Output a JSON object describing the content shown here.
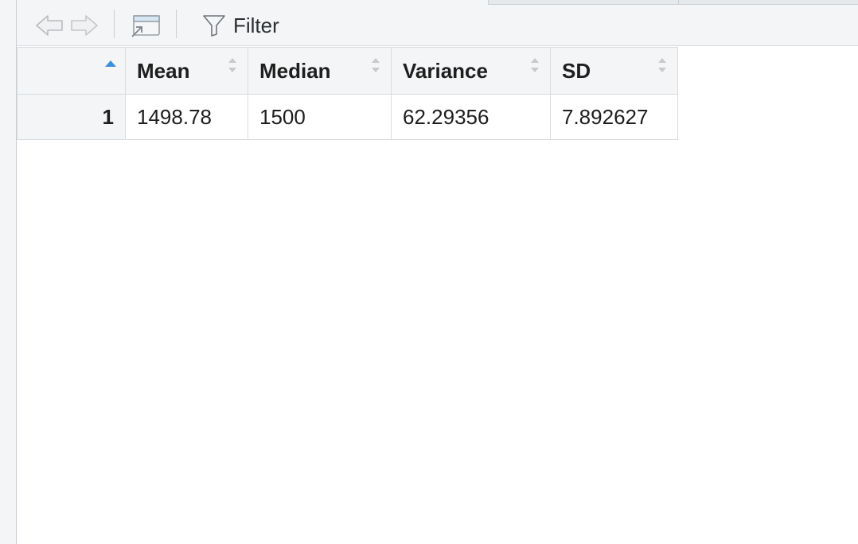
{
  "toolbar": {
    "back_icon": "arrow-left-icon",
    "forward_icon": "arrow-right-icon",
    "popout_icon": "popout-window-icon",
    "filter_icon": "funnel-icon",
    "filter_label": "Filter"
  },
  "table": {
    "sorted_column": "row-index",
    "sort_direction": "ascending",
    "columns": [
      "Mean",
      "Median",
      "Variance",
      "SD"
    ],
    "rows": [
      {
        "index": "1",
        "values": [
          "1498.78",
          "1500",
          "62.29356",
          "7.892627"
        ]
      }
    ]
  },
  "colors": {
    "sort_active": "#3c8fe0",
    "sort_inactive": "#c6cacd",
    "header_bg": "#f4f5f6",
    "border": "#d8dcdf"
  }
}
